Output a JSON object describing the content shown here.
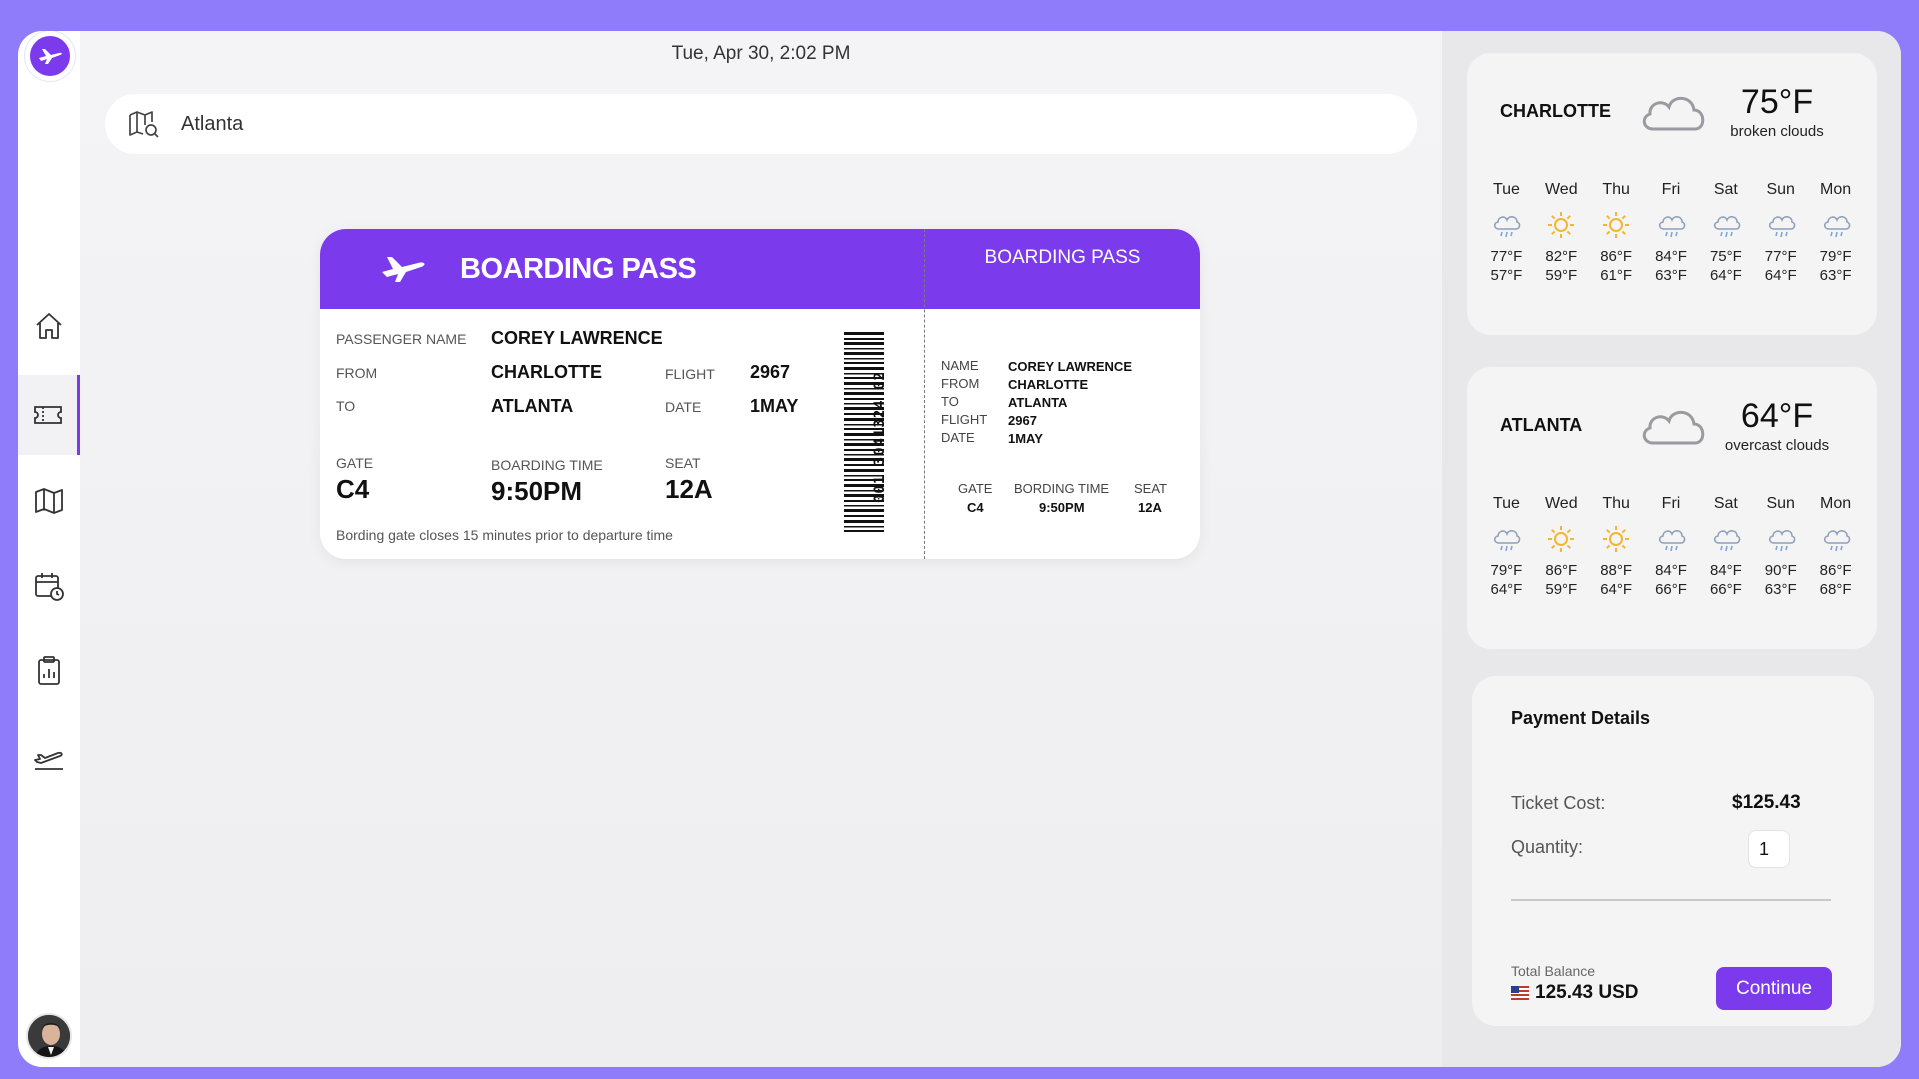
{
  "header": {
    "datetime": "Tue, Apr 30, 2:02 PM"
  },
  "search": {
    "value": "Atlanta",
    "icon": "map-search-icon"
  },
  "sidebar": {
    "items": [
      {
        "name": "home",
        "icon": "home-icon"
      },
      {
        "name": "tickets",
        "icon": "ticket-icon",
        "active": true
      },
      {
        "name": "map",
        "icon": "map-icon"
      },
      {
        "name": "schedule",
        "icon": "calendar-clock-icon"
      },
      {
        "name": "reports",
        "icon": "clipboard-chart-icon"
      },
      {
        "name": "flights",
        "icon": "plane-departure-icon"
      }
    ]
  },
  "boarding_pass": {
    "title": "BOARDING PASS",
    "passenger_label": "PASSENGER NAME",
    "passenger": "COREY LAWRENCE",
    "from_label": "FROM",
    "from": "CHARLOTTE",
    "to_label": "TO",
    "to": "ATLANTA",
    "flight_label": "FLIGHT",
    "flight": "2967",
    "date_label": "DATE",
    "date": "1MAY",
    "gate_label": "GATE",
    "gate": "C4",
    "boarding_time_label": "BOARDING TIME",
    "boarding_time": "9:50PM",
    "seat_label": "SEAT",
    "seat": "12A",
    "note": "Bording gate closes 15 minutes prior to departure time",
    "barcode_number": "001 3041324 02",
    "stub": {
      "title": "BOARDING PASS",
      "name_label": "NAME",
      "from_label": "FROM",
      "to_label": "TO",
      "flight_label": "FLIGHT",
      "date_label": "DATE",
      "name": "COREY LAWRENCE",
      "from": "CHARLOTTE",
      "to": "ATLANTA",
      "flight": "2967",
      "date": "1MAY",
      "gate_label": "GATE",
      "gate": "C4",
      "time_label": "BORDING TIME",
      "time": "9:50PM",
      "seat_label": "SEAT",
      "seat": "12A"
    }
  },
  "weather": [
    {
      "city": "CHARLOTTE",
      "temp": "75°F",
      "desc": "broken clouds",
      "icon": "cloud-icon",
      "days": [
        {
          "day": "Tue",
          "icon": "rain-cloud-icon",
          "hi": "77°F",
          "lo": "57°F"
        },
        {
          "day": "Wed",
          "icon": "sun-icon",
          "hi": "82°F",
          "lo": "59°F"
        },
        {
          "day": "Thu",
          "icon": "sun-icon",
          "hi": "86°F",
          "lo": "61°F"
        },
        {
          "day": "Fri",
          "icon": "rain-cloud-icon",
          "hi": "84°F",
          "lo": "63°F"
        },
        {
          "day": "Sat",
          "icon": "rain-cloud-icon",
          "hi": "75°F",
          "lo": "64°F"
        },
        {
          "day": "Sun",
          "icon": "rain-cloud-icon",
          "hi": "77°F",
          "lo": "64°F"
        },
        {
          "day": "Mon",
          "icon": "rain-cloud-icon",
          "hi": "79°F",
          "lo": "63°F"
        }
      ]
    },
    {
      "city": "ATLANTA",
      "temp": "64°F",
      "desc": "overcast clouds",
      "icon": "cloud-icon",
      "days": [
        {
          "day": "Tue",
          "icon": "rain-cloud-icon",
          "hi": "79°F",
          "lo": "64°F"
        },
        {
          "day": "Wed",
          "icon": "sun-icon",
          "hi": "86°F",
          "lo": "59°F"
        },
        {
          "day": "Thu",
          "icon": "sun-icon",
          "hi": "88°F",
          "lo": "64°F"
        },
        {
          "day": "Fri",
          "icon": "rain-cloud-icon",
          "hi": "84°F",
          "lo": "66°F"
        },
        {
          "day": "Sat",
          "icon": "rain-cloud-icon",
          "hi": "84°F",
          "lo": "66°F"
        },
        {
          "day": "Sun",
          "icon": "rain-cloud-icon",
          "hi": "90°F",
          "lo": "63°F"
        },
        {
          "day": "Mon",
          "icon": "rain-cloud-icon",
          "hi": "86°F",
          "lo": "68°F"
        }
      ]
    }
  ],
  "payment": {
    "title": "Payment Details",
    "ticket_cost_label": "Ticket Cost:",
    "ticket_cost": "$125.43",
    "quantity_label": "Quantity:",
    "quantity": "1",
    "total_label": "Total Balance",
    "total": "125.43 USD",
    "continue_label": "Continue"
  },
  "colors": {
    "accent": "#7c3aed",
    "frame": "#8f7cfb",
    "sun": "#f5b52e",
    "rain": "#8fa0b8"
  }
}
